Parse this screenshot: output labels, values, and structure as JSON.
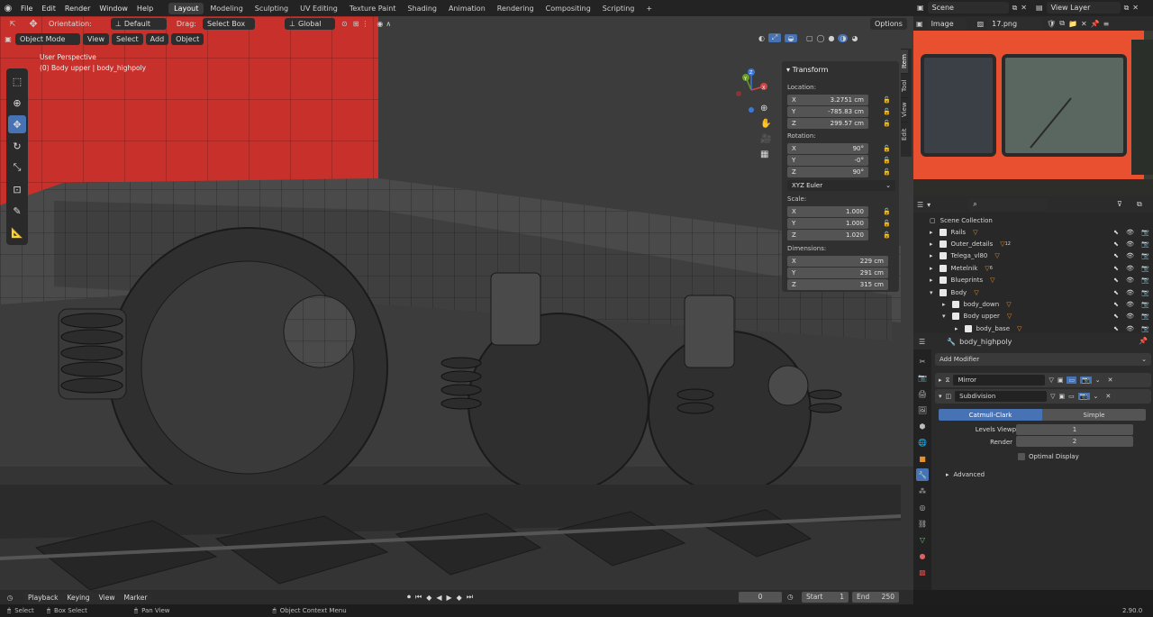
{
  "top_menu": [
    "File",
    "Edit",
    "Render",
    "Window",
    "Help"
  ],
  "workspaces": [
    "Layout",
    "Modeling",
    "Sculpting",
    "UV Editing",
    "Texture Paint",
    "Shading",
    "Animation",
    "Rendering",
    "Compositing",
    "Scripting"
  ],
  "active_workspace": "Layout",
  "add_workspace": "+",
  "scene_label": "Scene",
  "view_layer_label": "View Layer",
  "vp_toolbar": {
    "orientation_label": "Orientation:",
    "orientation_value": "Default",
    "drag_label": "Drag:",
    "drag_value": "Select Box",
    "transform_space": "Global",
    "options": "Options"
  },
  "vp_header": {
    "mode": "Object Mode",
    "menus": [
      "View",
      "Select",
      "Add",
      "Object"
    ]
  },
  "overlay_text": {
    "perspective": "User Perspective",
    "object": "(0) Body upper | body_highpoly"
  },
  "gizmo": {
    "x": "X",
    "y": "Y",
    "z": "Z"
  },
  "n_panel": {
    "title": "Transform",
    "location_label": "Location:",
    "location": [
      {
        "axis": "X",
        "value": "3.2751 cm"
      },
      {
        "axis": "Y",
        "value": "-785.83 cm"
      },
      {
        "axis": "Z",
        "value": "299.57 cm"
      }
    ],
    "rotation_label": "Rotation:",
    "rotation": [
      {
        "axis": "X",
        "value": "90°"
      },
      {
        "axis": "Y",
        "value": "-0°"
      },
      {
        "axis": "Z",
        "value": "90°"
      }
    ],
    "rotation_mode": "XYZ Euler",
    "scale_label": "Scale:",
    "scale": [
      {
        "axis": "X",
        "value": "1.000"
      },
      {
        "axis": "Y",
        "value": "1.000"
      },
      {
        "axis": "Z",
        "value": "1.020"
      }
    ],
    "dimensions_label": "Dimensions:",
    "dimensions": [
      {
        "axis": "X",
        "value": "229 cm"
      },
      {
        "axis": "Y",
        "value": "291 cm"
      },
      {
        "axis": "Z",
        "value": "315 cm"
      }
    ]
  },
  "side_tabs": [
    "Item",
    "Tool",
    "View",
    "Edit"
  ],
  "image_editor": {
    "mode": "Image",
    "file": "17.png"
  },
  "outliner": {
    "root": "Scene Collection",
    "items": [
      {
        "name": "Rails",
        "depth": 1,
        "expanded": false,
        "badge": ""
      },
      {
        "name": "Outer_details",
        "depth": 1,
        "expanded": false,
        "badge": "12"
      },
      {
        "name": "Telega_vl80",
        "depth": 1,
        "expanded": false,
        "badge": ""
      },
      {
        "name": "Metelnik",
        "depth": 1,
        "expanded": false,
        "badge": "6"
      },
      {
        "name": "Blueprints",
        "depth": 1,
        "expanded": false,
        "badge": ""
      },
      {
        "name": "Body",
        "depth": 1,
        "expanded": true,
        "badge": ""
      },
      {
        "name": "body_down",
        "depth": 2,
        "expanded": false,
        "badge": ""
      },
      {
        "name": "Body upper",
        "depth": 2,
        "expanded": true,
        "badge": ""
      },
      {
        "name": "body_base",
        "depth": 3,
        "expanded": false,
        "badge": ""
      }
    ]
  },
  "properties": {
    "object_name": "body_highpoly",
    "add_modifier": "Add Modifier",
    "modifiers": [
      "Mirror",
      "Subdivision"
    ],
    "subdiv_types": [
      "Catmull-Clark",
      "Simple"
    ],
    "active_subdiv_type": "Catmull-Clark",
    "levels_viewport_label": "Levels Viewport",
    "levels_viewport": "1",
    "render_label": "Render",
    "render": "2",
    "optimal_display": "Optimal Display",
    "advanced": "Advanced"
  },
  "timeline": {
    "menus": [
      "Playback",
      "Keying",
      "View",
      "Marker"
    ],
    "frame": "0",
    "start_label": "Start",
    "start": "1",
    "end_label": "End",
    "end": "250"
  },
  "status": {
    "select": "Select",
    "box_select": "Box Select",
    "pan_view": "Pan View",
    "context_menu": "Object Context Menu",
    "version": "2.90.0"
  },
  "colors": {
    "accent": "#4772b3",
    "train_red": "#c8312b",
    "panel": "#303030"
  }
}
